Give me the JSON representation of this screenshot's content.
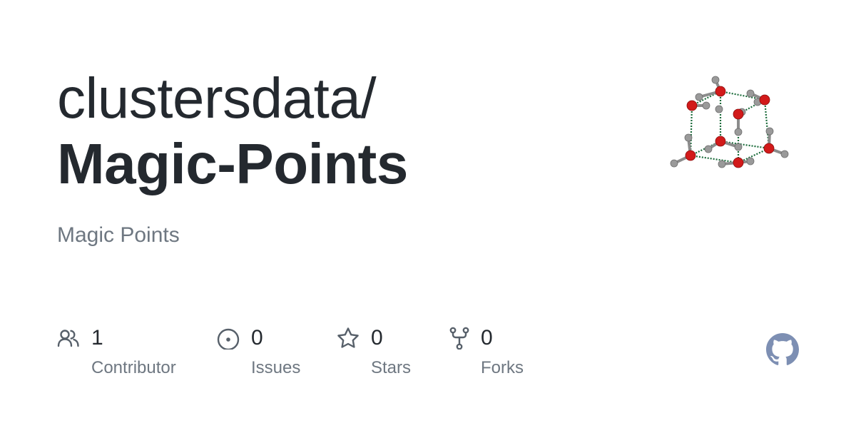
{
  "repo": {
    "owner": "clustersdata/",
    "name": "Magic-Points",
    "description": "Magic Points"
  },
  "stats": [
    {
      "icon": "people-icon",
      "value": "1",
      "label": "Contributor"
    },
    {
      "icon": "issue-icon",
      "value": "0",
      "label": "Issues"
    },
    {
      "icon": "star-icon",
      "value": "0",
      "label": "Stars"
    },
    {
      "icon": "fork-icon",
      "value": "0",
      "label": "Forks"
    }
  ],
  "colors": {
    "text": "#24292f",
    "muted": "#6e7781",
    "icon": "#57606a",
    "logo": "#7d8fb3",
    "atom_oxygen": "#d21a1a",
    "atom_hydrogen": "#9a9a9a",
    "bond": "#1a6b3a"
  },
  "logo_icon": "github-logo-icon",
  "avatar_icon": "molecule-cluster-icon"
}
